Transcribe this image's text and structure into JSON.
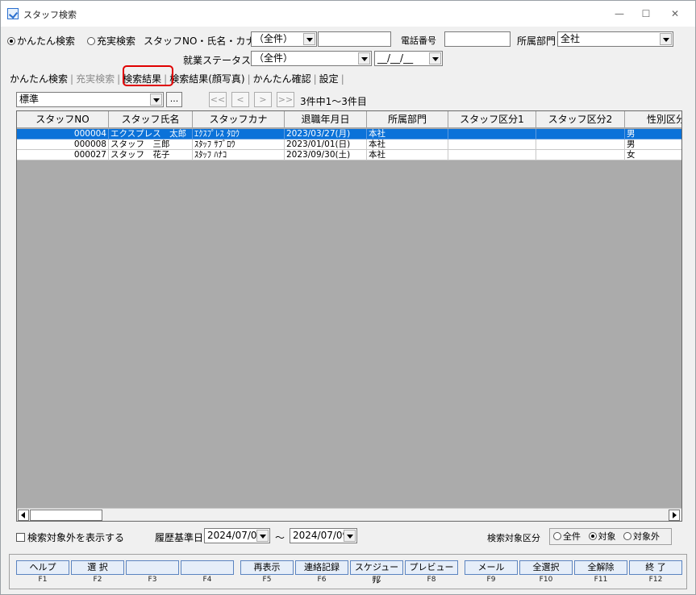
{
  "window": {
    "title": "スタッフ検索",
    "minimize": "—",
    "maximize": "☐",
    "close": "✕"
  },
  "search": {
    "mode_simple": "かんたん検索",
    "mode_full": "充実検索",
    "staff_label": "スタッフNO・氏名・カナ",
    "staff_select": "（全件）",
    "staff_text": "",
    "phone_label": "電話番号",
    "phone_value": "",
    "dept_label": "所属部門",
    "dept_value": "全社",
    "status_label": "就業ステータス",
    "status_value": "（全件）",
    "date_value": "__/__/__"
  },
  "tabs": [
    "かんたん検索",
    "充実検索",
    "検索結果",
    "検索結果(顔写真)",
    "かんたん確認",
    "設定"
  ],
  "toolbar": {
    "view_select": "標準",
    "ellipsis": "...",
    "nav_first": "<<",
    "nav_prev": "<",
    "nav_next": ">",
    "nav_last": ">>",
    "count_text": "3件中1～3件目"
  },
  "grid": {
    "headers": [
      "スタッフNO",
      "スタッフ氏名",
      "スタッフカナ",
      "退職年月日",
      "所属部門",
      "スタッフ区分1",
      "スタッフ区分2",
      "性別区分"
    ],
    "rows": [
      [
        "000004",
        "エクスプレス　太郎",
        "ｴｸｽﾌﾟﾚｽ ﾀﾛｳ",
        "2023/03/27(月)",
        "本社",
        "",
        "",
        "男"
      ],
      [
        "000008",
        "スタッフ　三郎",
        "ｽﾀｯﾌ ｻﾌﾞﾛｳ",
        "2023/01/01(日)",
        "本社",
        "",
        "",
        "男"
      ],
      [
        "000027",
        "スタッフ　花子",
        "ｽﾀｯﾌ ﾊﾅｺ",
        "2023/09/30(土)",
        "本社",
        "",
        "",
        "女"
      ]
    ]
  },
  "filters": {
    "show_excluded": "検索対象外を表示する",
    "history_label": "履歴基準日",
    "date_from": "2024/07/09",
    "tilde": "～",
    "date_to": "2024/07/09",
    "scope_label": "検索対象区分",
    "scope_all": "全件",
    "scope_target": "対象",
    "scope_excluded": "対象外"
  },
  "fkeys": [
    {
      "label": "ヘルプ",
      "key": "F1"
    },
    {
      "label": "選 択",
      "key": "F2"
    },
    {
      "label": "",
      "key": "F3"
    },
    {
      "label": "",
      "key": "F4"
    },
    {
      "label": "再表示",
      "key": "F5"
    },
    {
      "label": "連絡記録",
      "key": "F6"
    },
    {
      "label": "スケジュール",
      "key": "F7"
    },
    {
      "label": "プレビュー",
      "key": "F8"
    },
    {
      "label": "メール",
      "key": "F9"
    },
    {
      "label": "全選択",
      "key": "F10"
    },
    {
      "label": "全解除",
      "key": "F11"
    },
    {
      "label": "終 了",
      "key": "F12"
    }
  ]
}
